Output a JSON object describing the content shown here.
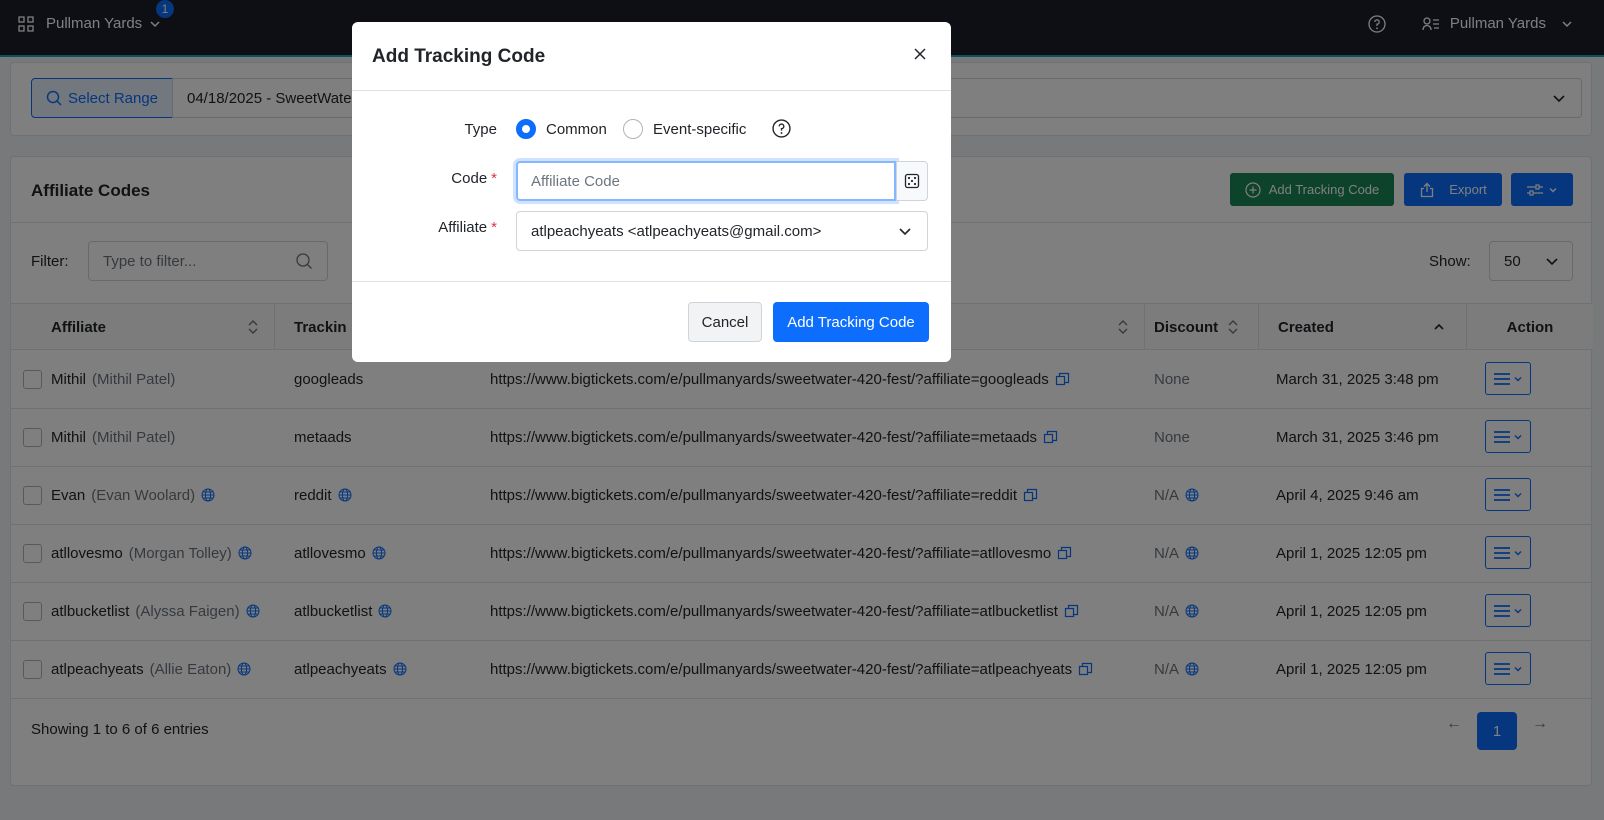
{
  "topbar": {
    "org_name": "Pullman Yards",
    "badge_count": "1",
    "user_name": "Pullman Yards"
  },
  "range": {
    "button_label": "Select Range",
    "selected_value": "04/18/2025 - SweetWate"
  },
  "card": {
    "title": "Affiliate Codes",
    "add_button": "Add Tracking Code",
    "export_button": "Export"
  },
  "filter": {
    "label": "Filter:",
    "placeholder": "Type to filter...",
    "show_label": "Show:",
    "show_value": "50"
  },
  "table": {
    "headers": {
      "affiliate": "Affiliate",
      "tracking": "Trackin",
      "discount": "Discount",
      "created": "Created",
      "action": "Action"
    },
    "rows": [
      {
        "name": "Mithil",
        "full": "(Mithil Patel)",
        "globe": false,
        "code": "googleads",
        "url": "https://www.bigtickets.com/e/pullmanyards/sweetwater-420-fest/?affiliate=googleads",
        "discount": "None",
        "created": "March 31, 2025 3:48 pm"
      },
      {
        "name": "Mithil",
        "full": "(Mithil Patel)",
        "globe": false,
        "code": "metaads",
        "url": "https://www.bigtickets.com/e/pullmanyards/sweetwater-420-fest/?affiliate=metaads",
        "discount": "None",
        "created": "March 31, 2025 3:46 pm"
      },
      {
        "name": "Evan",
        "full": "(Evan Woolard)",
        "globe": true,
        "code": "reddit",
        "url": "https://www.bigtickets.com/e/pullmanyards/sweetwater-420-fest/?affiliate=reddit",
        "discount": "N/A",
        "created": "April 4, 2025 9:46 am"
      },
      {
        "name": "atllovesmo",
        "full": "(Morgan Tolley)",
        "globe": true,
        "code": "atllovesmo",
        "url": "https://www.bigtickets.com/e/pullmanyards/sweetwater-420-fest/?affiliate=atllovesmo",
        "discount": "N/A",
        "created": "April 1, 2025 12:05 pm"
      },
      {
        "name": "atlbucketlist",
        "full": "(Alyssa Faigen)",
        "globe": true,
        "code": "atlbucketlist",
        "url": "https://www.bigtickets.com/e/pullmanyards/sweetwater-420-fest/?affiliate=atlbucketlist",
        "discount": "N/A",
        "created": "April 1, 2025 12:05 pm"
      },
      {
        "name": "atlpeachyeats",
        "full": "(Allie Eaton)",
        "globe": true,
        "code": "atlpeachyeats",
        "url": "https://www.bigtickets.com/e/pullmanyards/sweetwater-420-fest/?affiliate=atlpeachyeats",
        "discount": "N/A",
        "created": "April 1, 2025 12:05 pm"
      }
    ]
  },
  "footer": {
    "entries_text": "Showing 1 to 6 of 6 entries",
    "page": "1",
    "prev": "←",
    "next": "→"
  },
  "modal": {
    "title": "Add Tracking Code",
    "type_label": "Type",
    "type_option_common": "Common",
    "type_option_event": "Event-specific",
    "type_selected": "Common",
    "code_label": "Code",
    "code_placeholder": "Affiliate Code",
    "affiliate_label": "Affiliate",
    "required_mark": "*",
    "affiliate_value": "atlpeachyeats <atlpeachyeats@gmail.com>",
    "cancel_button": "Cancel",
    "submit_button": "Add Tracking Code"
  },
  "colors": {
    "primary": "#0d6efd",
    "success": "#198754",
    "topbar": "#1b1f2a",
    "danger": "#dc3545"
  }
}
